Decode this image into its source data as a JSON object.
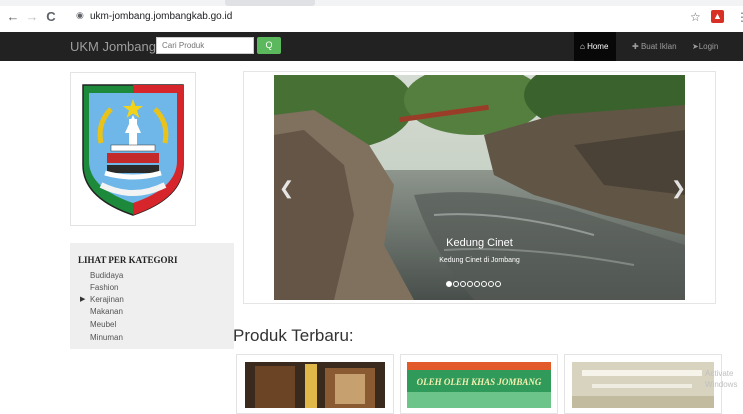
{
  "browser": {
    "url": "ukm-jombang.jombangkab.go.id",
    "back_icon": "←",
    "forward_icon": "→",
    "reload_icon": "C"
  },
  "navbar": {
    "brand": "UKM Jombang",
    "search_placeholder": "Cari Produk",
    "search_button": "Q",
    "links": [
      {
        "icon": "home-icon",
        "label": "Home"
      },
      {
        "icon": "plus-icon",
        "label": "Buat Iklan"
      },
      {
        "icon": "login-icon",
        "label": "Login"
      }
    ]
  },
  "sidebar": {
    "category_title": "LIHAT PER KATEGORI",
    "categories": [
      "Budidaya",
      "Fashion",
      "Kerajinan",
      "Makanan",
      "Meubel",
      "Minuman"
    ],
    "active_category": "Kerajinan"
  },
  "carousel": {
    "caption_title": "Kedung Cinet",
    "caption_text": "Kedung Cinet di Jombang",
    "slide_count": 8,
    "active_slide": 1
  },
  "products": {
    "heading": "Produk Terbaru:",
    "cards": [
      {
        "banner": ""
      },
      {
        "banner": "OLEH OLEH KHAS JOMBANG"
      },
      {
        "banner": ""
      }
    ]
  },
  "watermark": "Activate Windows",
  "colors": {
    "navbar": "#222222",
    "search_button": "#5cb85c",
    "shield_red": "#d7262b",
    "shield_green": "#1c8a3a"
  }
}
